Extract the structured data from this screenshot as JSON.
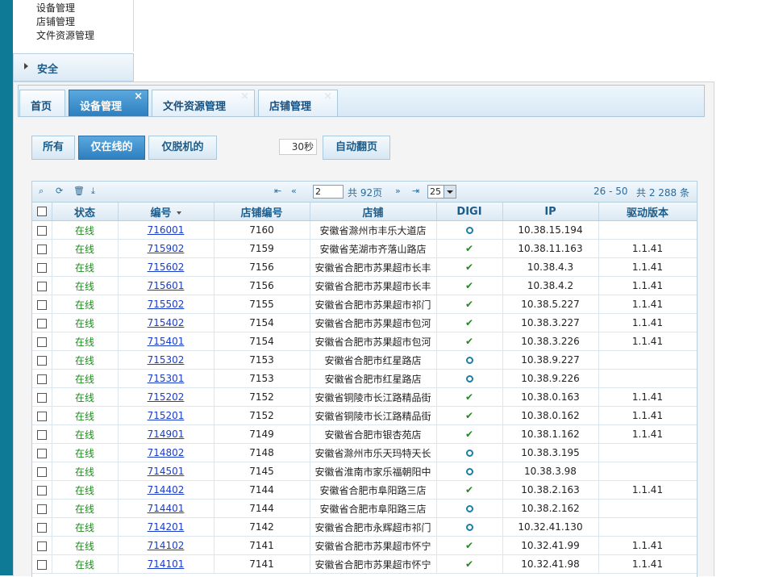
{
  "side_menu": {
    "items": [
      "设备管理",
      "店铺管理",
      "文件资源管理"
    ],
    "security_label": "安全"
  },
  "tabs": [
    {
      "label": "首页",
      "closable": false,
      "active": false
    },
    {
      "label": "设备管理",
      "closable": true,
      "active": true
    },
    {
      "label": "文件资源管理",
      "closable": true,
      "active": false
    },
    {
      "label": "店铺管理",
      "closable": true,
      "active": false
    }
  ],
  "filters": {
    "all": "所有",
    "online_only": "仅在线的",
    "offline_only": "仅脱机的",
    "active": "online_only"
  },
  "auto_page": {
    "interval_value": "30秒",
    "button": "自动翻页"
  },
  "pager": {
    "current_page": "2",
    "total_pages_text": "共 92页",
    "page_size": "25",
    "range_text": "26 - 50",
    "total_text": "共 2 288 条"
  },
  "columns": [
    "状态",
    "编号",
    "店铺编号",
    "店铺",
    "DIGI",
    "IP",
    "驱动版本"
  ],
  "rows": [
    {
      "status": "在线",
      "id": "716001",
      "store_no": "7160",
      "store": "安徽省滁州市丰乐大道店",
      "digi": "ring",
      "ip": "10.38.15.194",
      "driver": ""
    },
    {
      "status": "在线",
      "id": "715902",
      "store_no": "7159",
      "store": "安徽省芜湖市齐落山路店",
      "digi": "check",
      "ip": "10.38.11.163",
      "driver": "1.1.41"
    },
    {
      "status": "在线",
      "id": "715602",
      "store_no": "7156",
      "store": "安徽省合肥市苏果超市长丰",
      "digi": "check",
      "ip": "10.38.4.3",
      "driver": "1.1.41"
    },
    {
      "status": "在线",
      "id": "715601",
      "store_no": "7156",
      "store": "安徽省合肥市苏果超市长丰",
      "digi": "check",
      "ip": "10.38.4.2",
      "driver": "1.1.41"
    },
    {
      "status": "在线",
      "id": "715502",
      "store_no": "7155",
      "store": "安徽省合肥市苏果超市祁门",
      "digi": "check",
      "ip": "10.38.5.227",
      "driver": "1.1.41"
    },
    {
      "status": "在线",
      "id": "715402",
      "store_no": "7154",
      "store": "安徽省合肥市苏果超市包河",
      "digi": "check",
      "ip": "10.38.3.227",
      "driver": "1.1.41"
    },
    {
      "status": "在线",
      "id": "715401",
      "store_no": "7154",
      "store": "安徽省合肥市苏果超市包河",
      "digi": "check",
      "ip": "10.38.3.226",
      "driver": "1.1.41"
    },
    {
      "status": "在线",
      "id": "715302",
      "store_no": "7153",
      "store": "安徽省合肥市红星路店",
      "digi": "ring",
      "ip": "10.38.9.227",
      "driver": ""
    },
    {
      "status": "在线",
      "id": "715301",
      "store_no": "7153",
      "store": "安徽省合肥市红星路店",
      "digi": "ring",
      "ip": "10.38.9.226",
      "driver": ""
    },
    {
      "status": "在线",
      "id": "715202",
      "store_no": "7152",
      "store": "安徽省铜陵市长江路精品街",
      "digi": "check",
      "ip": "10.38.0.163",
      "driver": "1.1.41"
    },
    {
      "status": "在线",
      "id": "715201",
      "store_no": "7152",
      "store": "安徽省铜陵市长江路精品街",
      "digi": "check",
      "ip": "10.38.0.162",
      "driver": "1.1.41"
    },
    {
      "status": "在线",
      "id": "714901",
      "store_no": "7149",
      "store": "安徽省合肥市银杏苑店",
      "digi": "check",
      "ip": "10.38.1.162",
      "driver": "1.1.41"
    },
    {
      "status": "在线",
      "id": "714802",
      "store_no": "7148",
      "store": "安徽省滁州市乐天玛特天长",
      "digi": "ring",
      "ip": "10.38.3.195",
      "driver": ""
    },
    {
      "status": "在线",
      "id": "714501",
      "store_no": "7145",
      "store": "安徽省淮南市家乐福朝阳中",
      "digi": "ring",
      "ip": "10.38.3.98",
      "driver": ""
    },
    {
      "status": "在线",
      "id": "714402",
      "store_no": "7144",
      "store": "安徽省合肥市阜阳路三店",
      "digi": "check",
      "ip": "10.38.2.163",
      "driver": "1.1.41"
    },
    {
      "status": "在线",
      "id": "714401",
      "store_no": "7144",
      "store": "安徽省合肥市阜阳路三店",
      "digi": "ring",
      "ip": "10.38.2.162",
      "driver": ""
    },
    {
      "status": "在线",
      "id": "714201",
      "store_no": "7142",
      "store": "安徽省合肥市永辉超市祁门",
      "digi": "ring",
      "ip": "10.32.41.130",
      "driver": ""
    },
    {
      "status": "在线",
      "id": "714102",
      "store_no": "7141",
      "store": "安徽省合肥市苏果超市怀宁",
      "digi": "check",
      "ip": "10.32.41.99",
      "driver": "1.1.41"
    },
    {
      "status": "在线",
      "id": "714101",
      "store_no": "7141",
      "store": "安徽省合肥市苏果超市怀宁",
      "digi": "check",
      "ip": "10.32.41.98",
      "driver": "1.1.41"
    }
  ]
}
